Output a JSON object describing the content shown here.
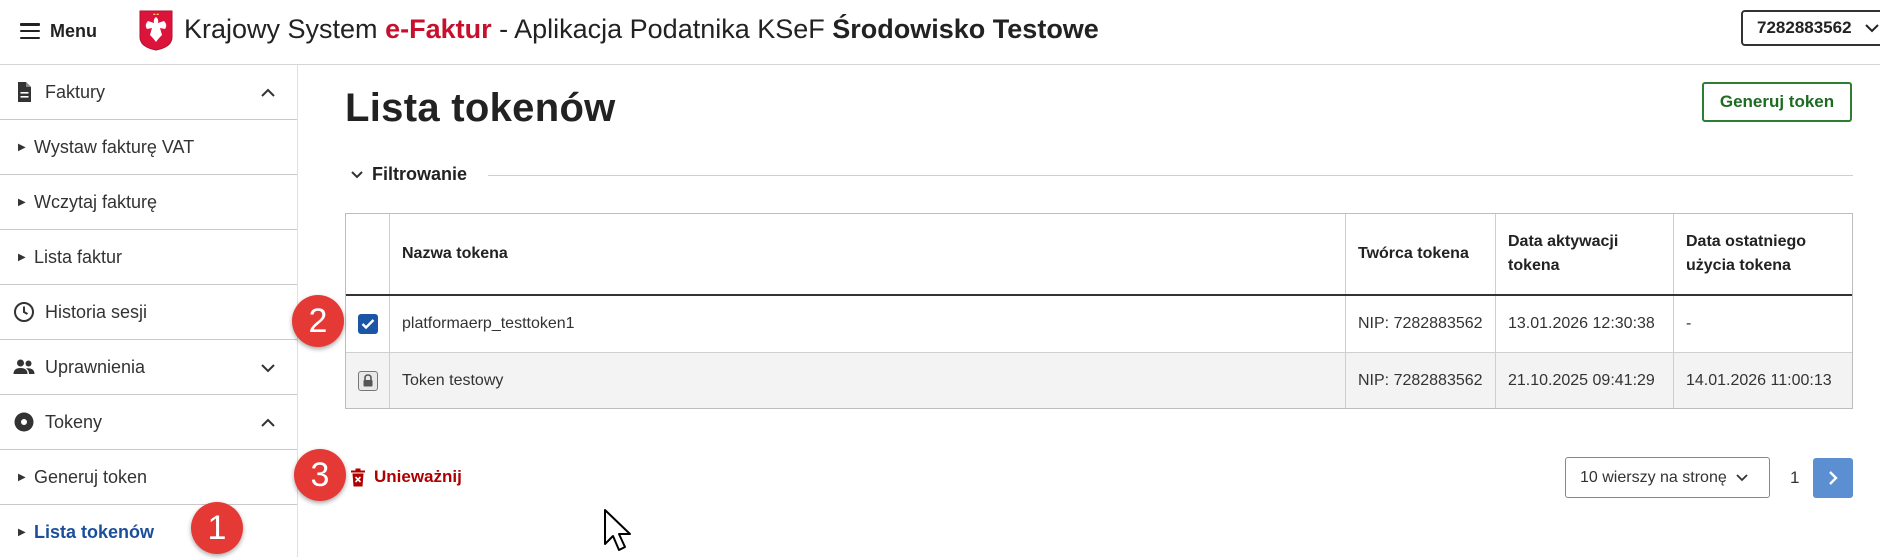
{
  "header": {
    "menu_label": "Menu",
    "title_pre": "Krajowy System ",
    "title_e": "e-Faktur",
    "title_mid": " - Aplikacja Podatnika KSeF ",
    "title_env": "Środowisko Testowe",
    "nip": "7282883562"
  },
  "sidebar": {
    "items": [
      {
        "label": "Faktury"
      },
      {
        "label": "Wystaw fakturę VAT"
      },
      {
        "label": "Wczytaj fakturę"
      },
      {
        "label": "Lista faktur"
      },
      {
        "label": "Historia sesji"
      },
      {
        "label": "Uprawnienia"
      },
      {
        "label": "Tokeny"
      },
      {
        "label": "Generuj token"
      },
      {
        "label": "Lista tokenów"
      }
    ]
  },
  "main": {
    "page_title": "Lista tokenów",
    "generate_button": "Generuj token",
    "filter_label": "Filtrowanie",
    "table": {
      "headers": [
        "Nazwa tokena",
        "Twórca tokena",
        "Data aktywacji tokena",
        "Data ostatniego użycia tokena"
      ],
      "rows": [
        {
          "name": "platformaerp_testtoken1",
          "creator": "NIP: 7282883562",
          "activated": "13.01.2026 12:30:38",
          "last_used": "-",
          "checked": true
        },
        {
          "name": "Token testowy",
          "creator": "NIP: 7282883562",
          "activated": "21.10.2025 09:41:29",
          "last_used": "14.01.2026 11:00:13",
          "locked": true
        }
      ]
    },
    "invalidate_label": "Unieważnij",
    "rows_per_page": "10 wierszy na stronę",
    "page_number": "1"
  },
  "annotations": [
    "1",
    "2",
    "3"
  ],
  "colors": {
    "accent_blue": "#1b4e9b",
    "brand_red": "#c8102e",
    "green_button": "#2e7d32",
    "danger_red": "#b00000",
    "badge_red": "#e53935",
    "next_button": "#5b8fd1"
  }
}
